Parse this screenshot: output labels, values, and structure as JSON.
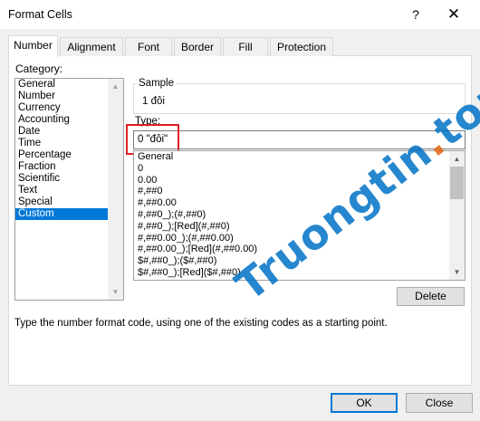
{
  "window": {
    "title": "Format Cells",
    "help": "?",
    "close": "✕"
  },
  "tabs": [
    {
      "label": "Number"
    },
    {
      "label": "Alignment"
    },
    {
      "label": "Font"
    },
    {
      "label": "Border"
    },
    {
      "label": "Fill"
    },
    {
      "label": "Protection"
    }
  ],
  "category": {
    "label": "Category:",
    "items": [
      "General",
      "Number",
      "Currency",
      "Accounting",
      "Date",
      "Time",
      "Percentage",
      "Fraction",
      "Scientific",
      "Text",
      "Special",
      "Custom"
    ],
    "selected": "Custom"
  },
  "sample": {
    "label": "Sample",
    "value": "1 đôi"
  },
  "type": {
    "label": "Type:",
    "value": "0 \"đôi\""
  },
  "formats": [
    "General",
    "0",
    "0.00",
    "#,##0",
    "#,##0.00",
    "#,##0_);(#,##0)",
    "#,##0_);[Red](#,##0)",
    "#,##0.00_);(#,##0.00)",
    "#,##0.00_);[Red](#,##0.00)",
    "$#,##0_);($#,##0)",
    "$#,##0_);[Red]($#,##0)"
  ],
  "buttons": {
    "delete": "Delete",
    "ok": "OK",
    "close": "Close"
  },
  "description": "Type the number format code, using one of the existing codes as a starting point.",
  "watermark": {
    "main": "Truongtin",
    "dot": ".",
    "tld": "top"
  },
  "colors": {
    "accent": "#0078d7",
    "highlight": "#e02020"
  }
}
